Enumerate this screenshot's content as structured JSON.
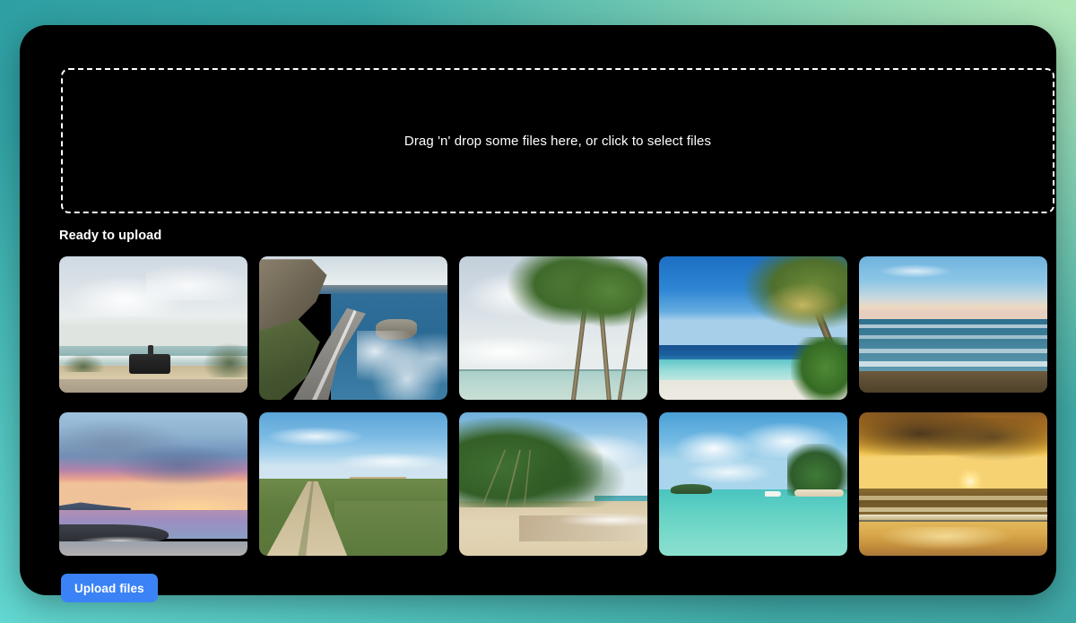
{
  "theme": {
    "card_background": "#000000",
    "accent_blue": "#3b82f6",
    "text_color": "#ffffff",
    "page_gradient_from": "#2e9fa3",
    "page_gradient_to": "#b3e8b8"
  },
  "dropzone": {
    "label": "Drag 'n' drop some files here, or click to select files",
    "border_style": "dashed",
    "border_color": "#ffffff"
  },
  "ready_section": {
    "title": "Ready to upload",
    "thumbnail_count": 10,
    "thumbnails": [
      {
        "name": "jeep-coastal-road",
        "alt": "Jeep parked on a sandy coastal road by a hazy sea"
      },
      {
        "name": "sea-cliff-bridge",
        "alt": "Highway bridge curving along a rocky sea cliff"
      },
      {
        "name": "palms-over-lagoon",
        "alt": "Palm trees leaning over a pale turquoise lagoon"
      },
      {
        "name": "tropical-beach-palm",
        "alt": "Deep blue sky over a turquoise tropical beach with a palm frond"
      },
      {
        "name": "dusk-surf-dark-sand",
        "alt": "Rolling surf at dusk with a dark sand foreground"
      },
      {
        "name": "pink-sunset-rocks",
        "alt": "Pink and blue sunset over a rocky beach"
      },
      {
        "name": "dirt-track-grassland",
        "alt": "Dirt track through coastal grassland beside blue sea"
      },
      {
        "name": "jungle-palms-beach",
        "alt": "Jungle palms lining a wide sandy beach"
      },
      {
        "name": "lagoon-boat-island",
        "alt": "Small boat on a turquoise lagoon near a palm island"
      },
      {
        "name": "golden-sunset-ocean",
        "alt": "Golden sunset over ocean waves and glowing wet sand"
      }
    ]
  },
  "actions": {
    "upload_label": "Upload files"
  }
}
